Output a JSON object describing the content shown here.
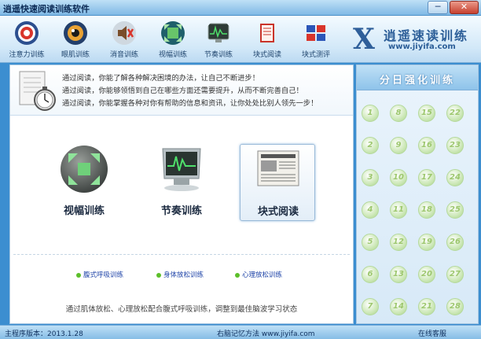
{
  "app": {
    "title": "逍遥快速阅读训练软件",
    "minimize": "─",
    "close": "✕"
  },
  "toolbar": [
    {
      "label": "注意力训练",
      "icon": "target-icon"
    },
    {
      "label": "眼肌训练",
      "icon": "eye-icon"
    },
    {
      "label": "消音训练",
      "icon": "mute-speaker-icon"
    },
    {
      "label": "视幅训练",
      "icon": "expand-view-icon"
    },
    {
      "label": "节奏训练",
      "icon": "monitor-chart-icon"
    },
    {
      "label": "块式阅读",
      "icon": "book-icon"
    },
    {
      "label": "块式测评",
      "icon": "blocks-icon"
    }
  ],
  "logo": {
    "mark": "X",
    "text": "逍遥速读训练",
    "url": "www.jiyifa.com"
  },
  "tips": [
    "通过阅读，你能了解各种解决困境的办法，让自己不断进步！",
    "通过阅读，你能够领悟到自己在哪些方面还需要提升，从而不断完善自己！",
    "通过阅读，你能掌握各种对你有帮助的信息和资讯，让你处处比别人领先一步！"
  ],
  "modules": [
    {
      "label": "视幅训练",
      "icon": "expand-arrows-icon"
    },
    {
      "label": "节奏训练",
      "icon": "monitor-waveform-icon"
    },
    {
      "label": "块式阅读",
      "icon": "newspaper-icon",
      "selected": true
    }
  ],
  "subs": [
    "腹式呼吸训练",
    "身体放松训练",
    "心理放松训练"
  ],
  "description": "通过肌体放松、心理放松配合腹式呼吸训练，调整到最佳脑波学习状态",
  "sidebar": {
    "title": "分日强化训练",
    "days": [
      "1",
      "2",
      "3",
      "4",
      "5",
      "6",
      "7",
      "8",
      "9",
      "10",
      "11",
      "12",
      "13",
      "14",
      "15",
      "16",
      "17",
      "18",
      "19",
      "20",
      "21",
      "22",
      "23",
      "24",
      "25",
      "26",
      "27",
      "28"
    ]
  },
  "status": {
    "version": "主程序版本：2013.1.28",
    "site": "右脑记忆方法 www.jiyifa.com",
    "service": "在线客服"
  },
  "colors": {
    "accent": "#3c8ed0",
    "day_circle": "#a9d38a",
    "link": "#1f44a8"
  }
}
